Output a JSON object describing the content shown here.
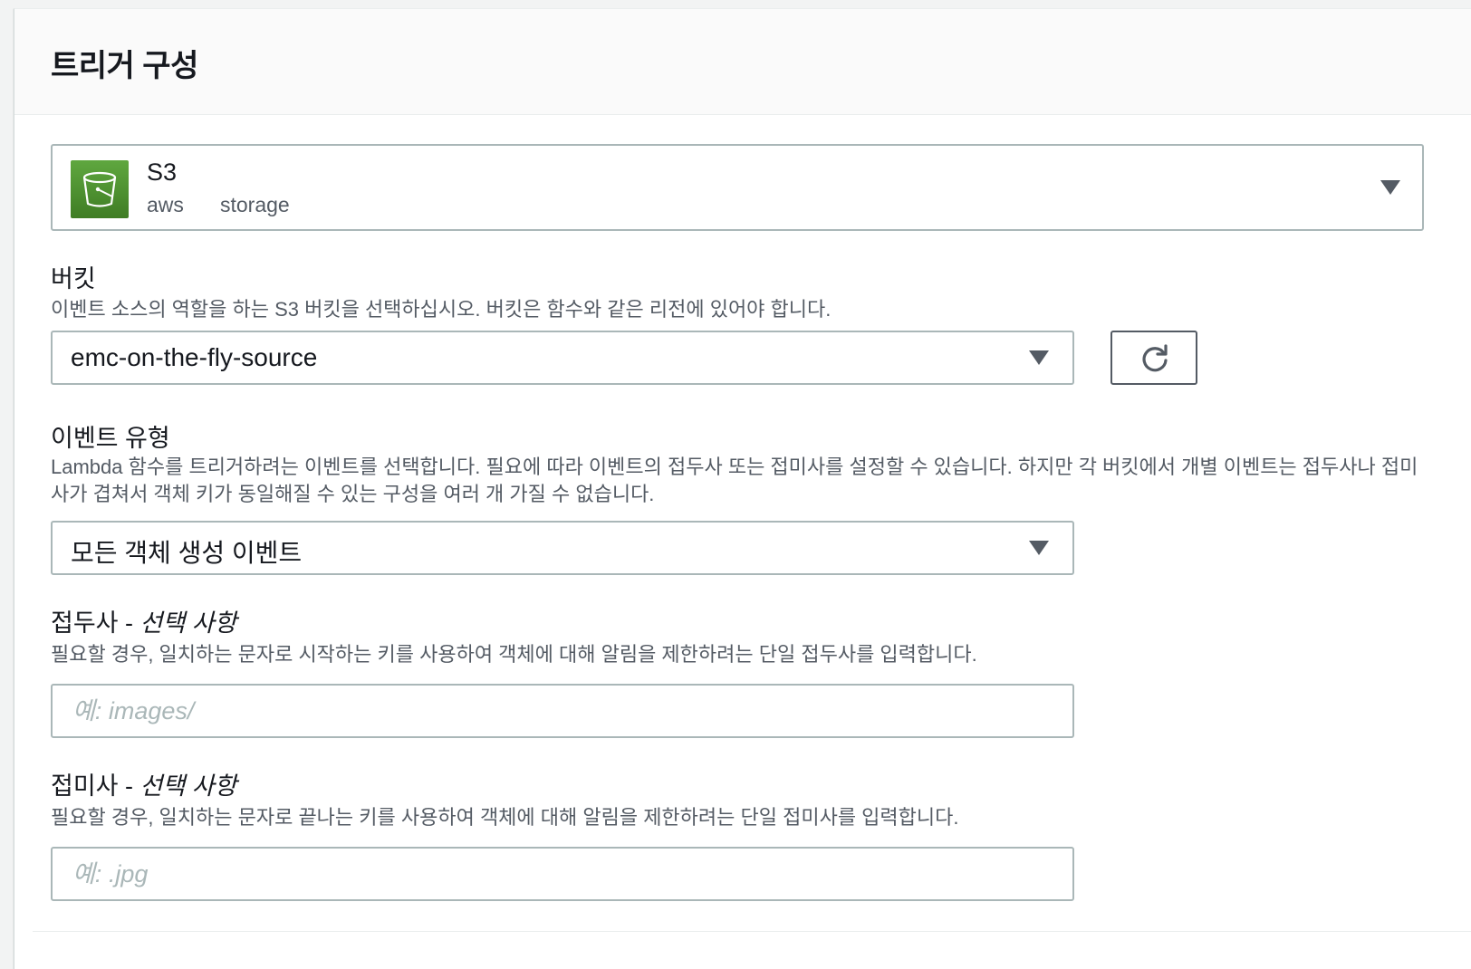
{
  "section": {
    "title": "트리거 구성"
  },
  "trigger": {
    "name": "S3",
    "tags": [
      "aws",
      "storage"
    ],
    "icon": "s3-bucket-icon",
    "icon_color": "#4e9132"
  },
  "bucket": {
    "label": "버킷",
    "description": "이벤트 소스의 역할을 하는 S3 버킷을 선택하십시오. 버킷은 함수와 같은 리전에 있어야 합니다.",
    "selected": "emc-on-the-fly-source",
    "refresh_icon": "refresh-icon"
  },
  "event_type": {
    "label": "이벤트 유형",
    "description": "Lambda 함수를 트리거하려는 이벤트를 선택합니다. 필요에 따라 이벤트의 접두사 또는 접미사를 설정할 수 있습니다. 하지만 각 버킷에서 개별 이벤트는 접두사나 접미사가 겹쳐서 객체 키가 동일해질 수 있는 구성을 여러 개 가질 수 없습니다.",
    "selected": "모든 객체 생성 이벤트"
  },
  "prefix": {
    "label": "접두사 - ",
    "optional": "선택 사항",
    "description": "필요할 경우, 일치하는 문자로 시작하는 키를 사용하여 객체에 대해 알림을 제한하려는 단일 접두사를 입력합니다.",
    "value": "",
    "placeholder": "예: images/"
  },
  "suffix": {
    "label": "접미사 - ",
    "optional": "선택 사항",
    "description": "필요할 경우, 일치하는 문자로 끝나는 키를 사용하여 객체에 대해 알림을 제한하려는 단일 접미사를 입력합니다.",
    "value": "",
    "placeholder": "예: .jpg"
  }
}
